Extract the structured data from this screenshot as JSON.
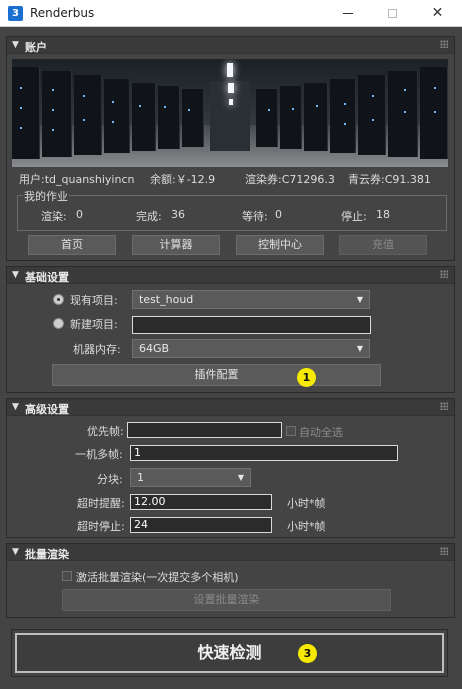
{
  "window": {
    "title": "Renderbus",
    "app_icon": "3"
  },
  "account": {
    "header": "账户",
    "user": "用户:td_quanshiyincn",
    "balance": "余额:￥-12.9",
    "render_coupon": "渲染券:C71296.3",
    "cloud_coupon": "青云券:C91.381",
    "jobs_legend": "我的作业",
    "rendering": "渲染:",
    "rendering_val": "0",
    "done": "完成:",
    "done_val": "36",
    "waiting": "等待:",
    "waiting_val": "0",
    "stopped": "停止:",
    "stopped_val": "18",
    "buttons": {
      "home": "首页",
      "calculator": "计算器",
      "console": "控制中心",
      "recharge": "充值"
    }
  },
  "basic": {
    "header": "基础设置",
    "existing_project_label": "现有项目:",
    "existing_project_value": "test_houd",
    "new_project_label": "新建项目:",
    "new_project_value": "",
    "memory_label": "机器内存:",
    "memory_value": "64GB",
    "plugin_button": "插件配置",
    "badge": "1"
  },
  "advanced": {
    "header": "高级设置",
    "priority_label": "优先帧:",
    "priority_value": "",
    "auto_all_label": "自动全选",
    "multi_frame_label": "一机多帧:",
    "multi_frame_value": "1",
    "chunk_label": "分块:",
    "chunk_value": "1",
    "timeout_warn_label": "超时提醒:",
    "timeout_warn_value": "12.00",
    "timeout_warn_unit": "小时*帧",
    "timeout_stop_label": "超时停止:",
    "timeout_stop_value": "24",
    "timeout_stop_unit": "小时*帧"
  },
  "batch": {
    "header": "批量渲染",
    "activate_label": "激活批量渲染(一次提交多个相机)",
    "setup_button": "设置批量渲染"
  },
  "quick_check": {
    "label": "快速检测",
    "badge": "3"
  },
  "colors": {
    "panel_bg": "#444444",
    "badge_yellow": "#f7ea00",
    "titlebar": "#ffffff"
  }
}
